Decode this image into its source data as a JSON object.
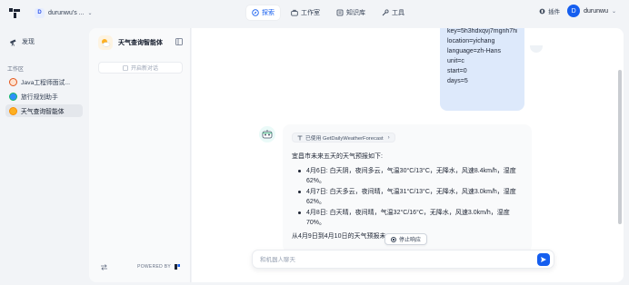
{
  "topbar": {
    "workspace_badge": "D",
    "workspace_name": "durunwu's ...",
    "nav": [
      {
        "label": "探索",
        "icon": "compass-icon",
        "active": true
      },
      {
        "label": "工作室",
        "icon": "toolbox-icon",
        "active": false
      },
      {
        "label": "知识库",
        "icon": "book-icon",
        "active": false
      },
      {
        "label": "工具",
        "icon": "tools-icon",
        "active": false
      }
    ],
    "plugin_label": "插件",
    "user_initial": "D",
    "user_name": "durunwu"
  },
  "sidebar": {
    "discover_label": "发现",
    "section_label": "工作区",
    "apps": [
      {
        "label": "Java工程师面试...",
        "icon": "java-icon",
        "active": false
      },
      {
        "label": "旅行规划助手",
        "icon": "globe-icon",
        "active": false
      },
      {
        "label": "天气查询智能体",
        "icon": "weather-icon",
        "active": true
      }
    ]
  },
  "panel": {
    "app_title": "天气查询智能体",
    "new_chat_label": "开启新对话",
    "powered_by": "POWERED BY"
  },
  "chat": {
    "user_message_lines": [
      "key=5h3hdxqvj7mgnh7hnn",
      "location=yichang",
      "language=zh-Hans",
      "unit=c",
      "start=0",
      "days=5"
    ],
    "tool_used": "已使用 GetDailyWeatherForecast",
    "intro": "宜昌市未来五天的天气预报如下:",
    "forecast": [
      "4月6日: 白天阴，夜间多云，气温30°C/13°C，无降水，风速8.4km/h，湿度62%。",
      "4月7日: 白天多云，夜间晴，气温31°C/13°C，无降水，风速3.0km/h，湿度62%。",
      "4月8日: 白天晴，夜间晴，气温32°C/16°C，无降水，风速3.0km/h，湿度70%。"
    ],
    "tail": "从4月9日到4月10日的天气预报未",
    "stop_label": "停止响应",
    "input_placeholder": "和机器人聊天"
  },
  "colors": {
    "accent": "#155eef",
    "user_bubble": "#dde9fb",
    "active_item": "#e4e7ec"
  }
}
